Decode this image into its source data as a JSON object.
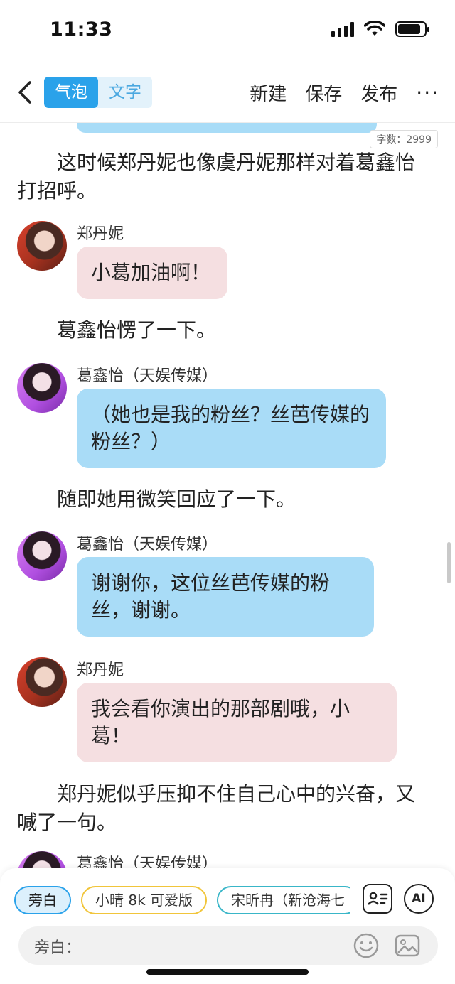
{
  "status": {
    "time": "11:33",
    "battery_level": 0.85
  },
  "nav": {
    "segments": [
      "气泡",
      "文字"
    ],
    "active_segment": "气泡",
    "actions": [
      "新建",
      "保存",
      "发布"
    ],
    "more": "···"
  },
  "word_count": "字数：2999",
  "story": [
    {
      "type": "narration",
      "text": "这时候郑丹妮也像虞丹妮那样对着葛鑫怡打招呼。"
    },
    {
      "type": "message",
      "sender": "郑丹妮",
      "text": "小葛加油啊！",
      "bubble_color": "#f5dfe1",
      "avatar": "avatar-zhengdanni"
    },
    {
      "type": "narration",
      "text": "葛鑫怡愣了一下。"
    },
    {
      "type": "message",
      "sender": "葛鑫怡（天娱传媒）",
      "text": "（她也是我的粉丝？丝芭传媒的粉丝？）",
      "bubble_color": "#a9dcf7",
      "avatar": "avatar-gexinyi"
    },
    {
      "type": "narration",
      "text": "随即她用微笑回应了一下。"
    },
    {
      "type": "message",
      "sender": "葛鑫怡（天娱传媒）",
      "text": "谢谢你，这位丝芭传媒的粉丝，谢谢。",
      "bubble_color": "#a9dcf7",
      "avatar": "avatar-gexinyi"
    },
    {
      "type": "message",
      "sender": "郑丹妮",
      "text": "我会看你演出的那部剧哦，小葛！",
      "bubble_color": "#f5dfe1",
      "avatar": "avatar-zhengdanni"
    },
    {
      "type": "narration",
      "text": "郑丹妮似乎压抑不住自己心中的兴奋，又喊了一句。"
    },
    {
      "type": "message",
      "sender": "葛鑫怡（天娱传媒）",
      "text": "",
      "bubble_color": "#a9dcf7",
      "avatar": "avatar-gexinyi"
    }
  ],
  "roles": [
    "旁白",
    "小晴 8k 可爱版",
    "宋昕冉（新沧海七"
  ],
  "selected_role": "旁白",
  "toolbar": {
    "contacts_icon": "contact-card-icon",
    "ai_label": "AI"
  },
  "input": {
    "label": "旁白：",
    "placeholder": "",
    "emoji_icon": "smile-icon",
    "image_icon": "image-icon"
  }
}
